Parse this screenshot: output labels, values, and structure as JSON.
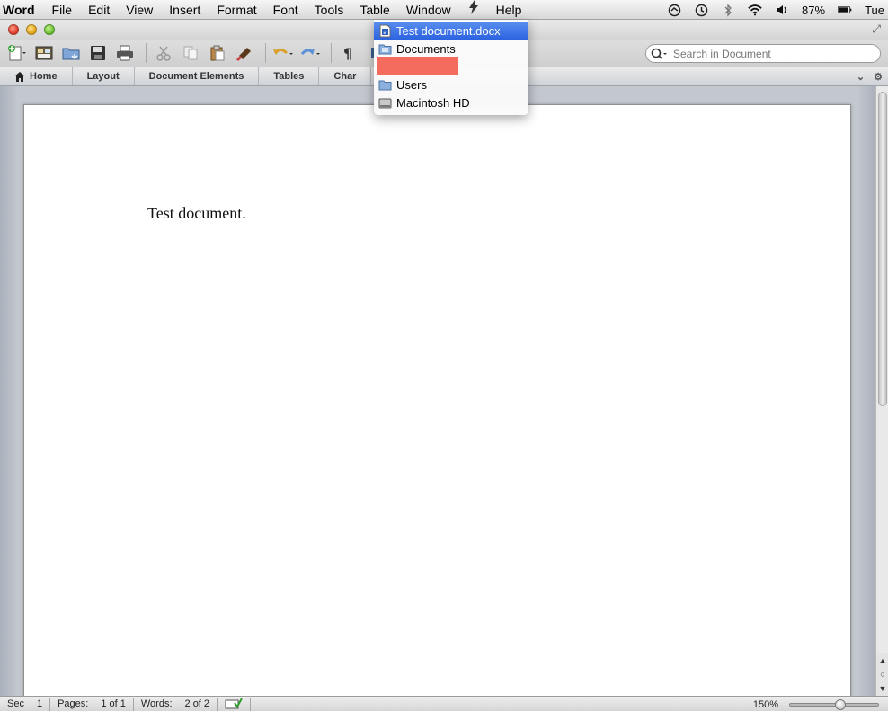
{
  "menubar": {
    "app_name": "Word",
    "items": [
      "File",
      "Edit",
      "View",
      "Insert",
      "Format",
      "Font",
      "Tools",
      "Table",
      "Window",
      "Help"
    ],
    "battery": "87%",
    "clock": "Tue"
  },
  "toolbar": {
    "search_placeholder": "Search in Document"
  },
  "ribbon": {
    "tabs": [
      "Home",
      "Layout",
      "Document Elements",
      "Tables",
      "Char"
    ]
  },
  "path_menu": {
    "items": [
      {
        "label": "Test document.docx",
        "icon": "document-icon",
        "selected": true
      },
      {
        "label": "Documents",
        "icon": "folder-icon",
        "selected": false
      },
      {
        "label": "",
        "icon": "",
        "selected": false,
        "redacted": true
      },
      {
        "label": "Users",
        "icon": "folder-icon",
        "selected": false
      },
      {
        "label": "Macintosh HD",
        "icon": "hard-drive-icon",
        "selected": false
      }
    ]
  },
  "document": {
    "text": "Test document."
  },
  "statusbar": {
    "sec_label": "Sec",
    "sec_value": "1",
    "pages_label": "Pages:",
    "pages_value": "1 of 1",
    "words_label": "Words:",
    "words_value": "2 of 2",
    "zoom": "150%"
  },
  "colors": {
    "selection": "#2c63e0",
    "redaction": "#f46c5e"
  }
}
